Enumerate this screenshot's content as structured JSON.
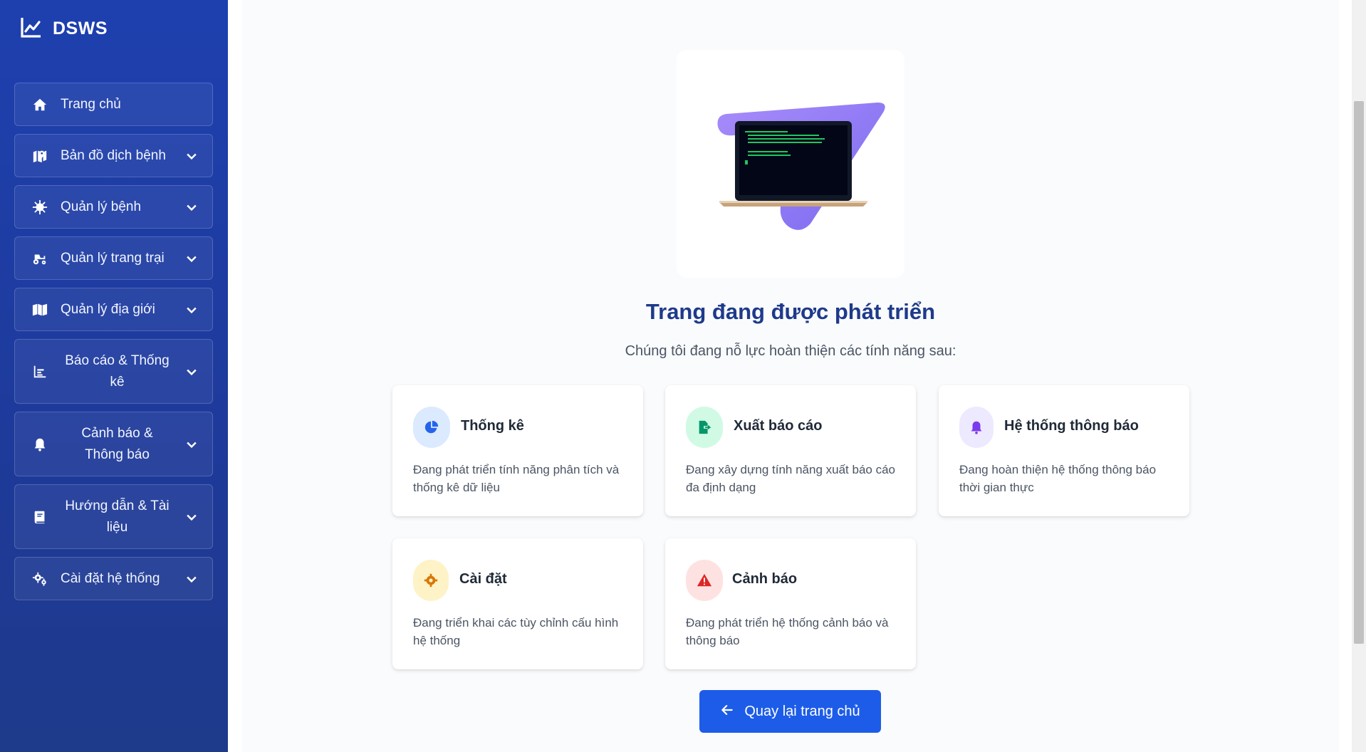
{
  "brand": {
    "name": "DSWS",
    "icon": "chart-line-icon"
  },
  "sidebar": {
    "items": [
      {
        "label": "Trang chủ",
        "icon": "home-icon",
        "has_chevron": false
      },
      {
        "label": "Bản đồ dịch bệnh",
        "icon": "map-marker-icon",
        "has_chevron": true
      },
      {
        "label": "Quản lý bệnh",
        "icon": "virus-icon",
        "has_chevron": true
      },
      {
        "label": "Quản lý trang trại",
        "icon": "tractor-icon",
        "has_chevron": true
      },
      {
        "label": "Quản lý địa giới",
        "icon": "map-icon",
        "has_chevron": true
      },
      {
        "label": "Báo cáo & Thống kê",
        "icon": "chart-bar-icon",
        "has_chevron": true
      },
      {
        "label": "Cảnh báo & Thông báo",
        "icon": "bell-icon",
        "has_chevron": true
      },
      {
        "label": "Hướng dẫn & Tài liệu",
        "icon": "book-icon",
        "has_chevron": true
      },
      {
        "label": "Cài đặt hệ thống",
        "icon": "cogs-icon",
        "has_chevron": true
      }
    ]
  },
  "main": {
    "title": "Trang đang được phát triển",
    "subtitle": "Chúng tôi đang nỗ lực hoàn thiện các tính năng sau:",
    "features": [
      {
        "title": "Thống kê",
        "description": "Đang phát triển tính năng phân tích và thống kê dữ liệu",
        "icon": "pie-chart-icon",
        "color": "#2563eb",
        "bg": "#dbeafe"
      },
      {
        "title": "Xuất báo cáo",
        "description": "Đang xây dựng tính năng xuất báo cáo đa định dạng",
        "icon": "file-export-icon",
        "color": "#059669",
        "bg": "#d1fae5"
      },
      {
        "title": "Hệ thống thông báo",
        "description": "Đang hoàn thiện hệ thống thông báo thời gian thực",
        "icon": "bell-icon",
        "color": "#7c3aed",
        "bg": "#ede9fe"
      },
      {
        "title": "Cài đặt",
        "description": "Đang triển khai các tùy chỉnh cấu hình hệ thống",
        "icon": "gear-icon",
        "color": "#d97706",
        "bg": "#fef3c7"
      },
      {
        "title": "Cảnh báo",
        "description": "Đang phát triển hệ thống cảnh báo và thông báo",
        "icon": "warning-icon",
        "color": "#dc2626",
        "bg": "#fee2e2"
      }
    ],
    "back_button": {
      "label": "Quay lại trang chủ",
      "icon": "arrow-left-icon"
    }
  },
  "colors": {
    "sidebar": "#1e40af",
    "title": "#1e3a8a",
    "primary_button": "#1d5ce8"
  }
}
